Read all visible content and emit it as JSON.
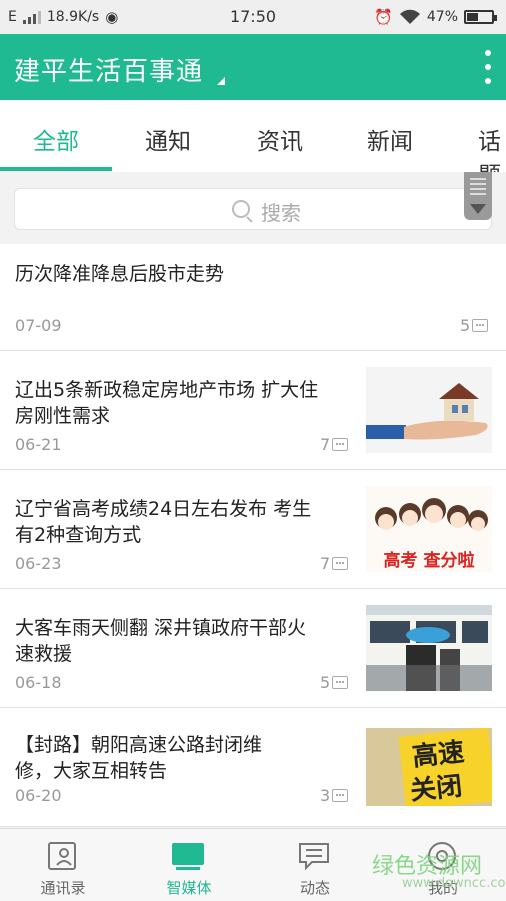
{
  "statusbar": {
    "carrier": "E",
    "speed": "18.9K/s",
    "time": "17:50",
    "battery": "47%",
    "battery_level": 0.47
  },
  "appbar": {
    "title": "建平生活百事通"
  },
  "tabs": [
    {
      "label": "全部",
      "active": true
    },
    {
      "label": "通知",
      "active": false
    },
    {
      "label": "资讯",
      "active": false
    },
    {
      "label": "新闻",
      "active": false
    },
    {
      "label": "话题",
      "active": false
    }
  ],
  "search": {
    "placeholder": "搜索"
  },
  "news": [
    {
      "title": "历次降准降息后股市走势",
      "date": "07-09",
      "comments": "5",
      "has_thumb": false
    },
    {
      "title_lines": [
        "辽出5条新政稳定房地产市场 扩大住",
        "房刚性需求"
      ],
      "date": "06-21",
      "comments": "7",
      "has_thumb": true
    },
    {
      "title_lines": [
        "辽宁省高考成绩24日左右发布 考生",
        "有2种查询方式"
      ],
      "date": "06-23",
      "comments": "7",
      "has_thumb": true,
      "thumb_text": "高考 查分啦"
    },
    {
      "title_lines": [
        "大客车雨天侧翻 深井镇政府干部火",
        "速救援"
      ],
      "date": "06-18",
      "comments": "5",
      "has_thumb": true
    },
    {
      "title_lines": [
        "【封路】朝阳高速公路封闭维",
        "修，大家互相转告"
      ],
      "date": "06-20",
      "comments": "3",
      "has_thumb": true,
      "thumb_text": [
        "高速",
        "关闭"
      ]
    }
  ],
  "bottomnav": [
    {
      "label": "通讯录",
      "active": false
    },
    {
      "label": "智媒体",
      "active": true
    },
    {
      "label": "动态",
      "active": false
    },
    {
      "label": "我的",
      "active": false
    }
  ],
  "watermark": {
    "text": "绿色资源网",
    "sub": "www.downcc.com"
  },
  "colors": {
    "accent": "#1fb992",
    "background": "#f2f2f2"
  }
}
